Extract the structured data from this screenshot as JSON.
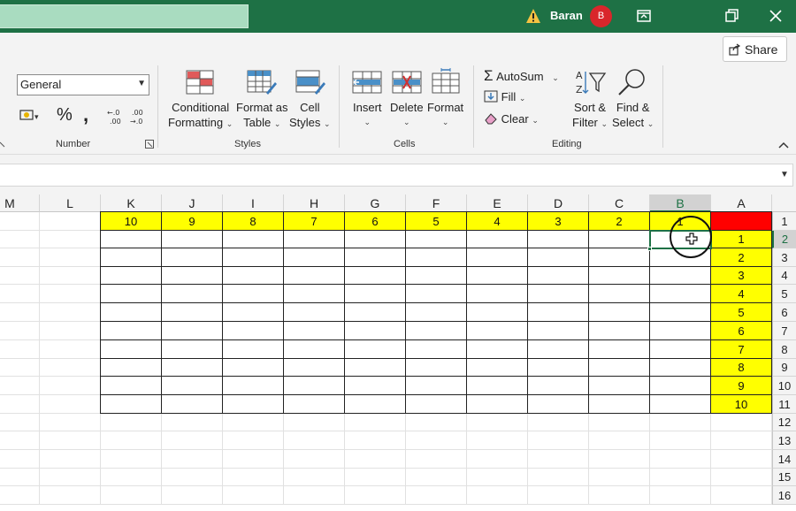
{
  "titlebar": {
    "user_name": "Baran",
    "avatar_initial": "B"
  },
  "ribbon": {
    "share_label": "Share",
    "number_format": "General",
    "groups": {
      "number": "Number",
      "styles": "Styles",
      "cells": "Cells",
      "editing": "Editing"
    },
    "buttons": {
      "conditional_formatting": [
        "Conditional",
        "Formatting"
      ],
      "format_as_table": [
        "Format as",
        "Table"
      ],
      "cell_styles": [
        "Cell",
        "Styles"
      ],
      "insert": "Insert",
      "delete": "Delete",
      "format": "Format",
      "autosum": "AutoSum",
      "fill": "Fill",
      "clear": "Clear",
      "sort_filter": [
        "Sort &",
        "Filter"
      ],
      "find_select": [
        "Find &",
        "Select"
      ]
    }
  },
  "grid": {
    "columns": [
      "M",
      "L",
      "K",
      "J",
      "I",
      "H",
      "G",
      "F",
      "E",
      "D",
      "C",
      "B",
      "A"
    ],
    "rows": [
      "1",
      "2",
      "3",
      "4",
      "5",
      "6",
      "7",
      "8",
      "9",
      "10",
      "11",
      "12",
      "13",
      "14",
      "15",
      "16"
    ],
    "selected_column": "B",
    "selected_row": "2",
    "row1_values": [
      "10",
      "9",
      "8",
      "7",
      "6",
      "5",
      "4",
      "3",
      "2",
      "1"
    ],
    "colA_values": [
      "1",
      "2",
      "3",
      "4",
      "5",
      "6",
      "7",
      "8",
      "9",
      "10"
    ],
    "colors": {
      "highlight": "#ffff00",
      "corner": "#ff0000",
      "accent": "#1e7145"
    }
  }
}
